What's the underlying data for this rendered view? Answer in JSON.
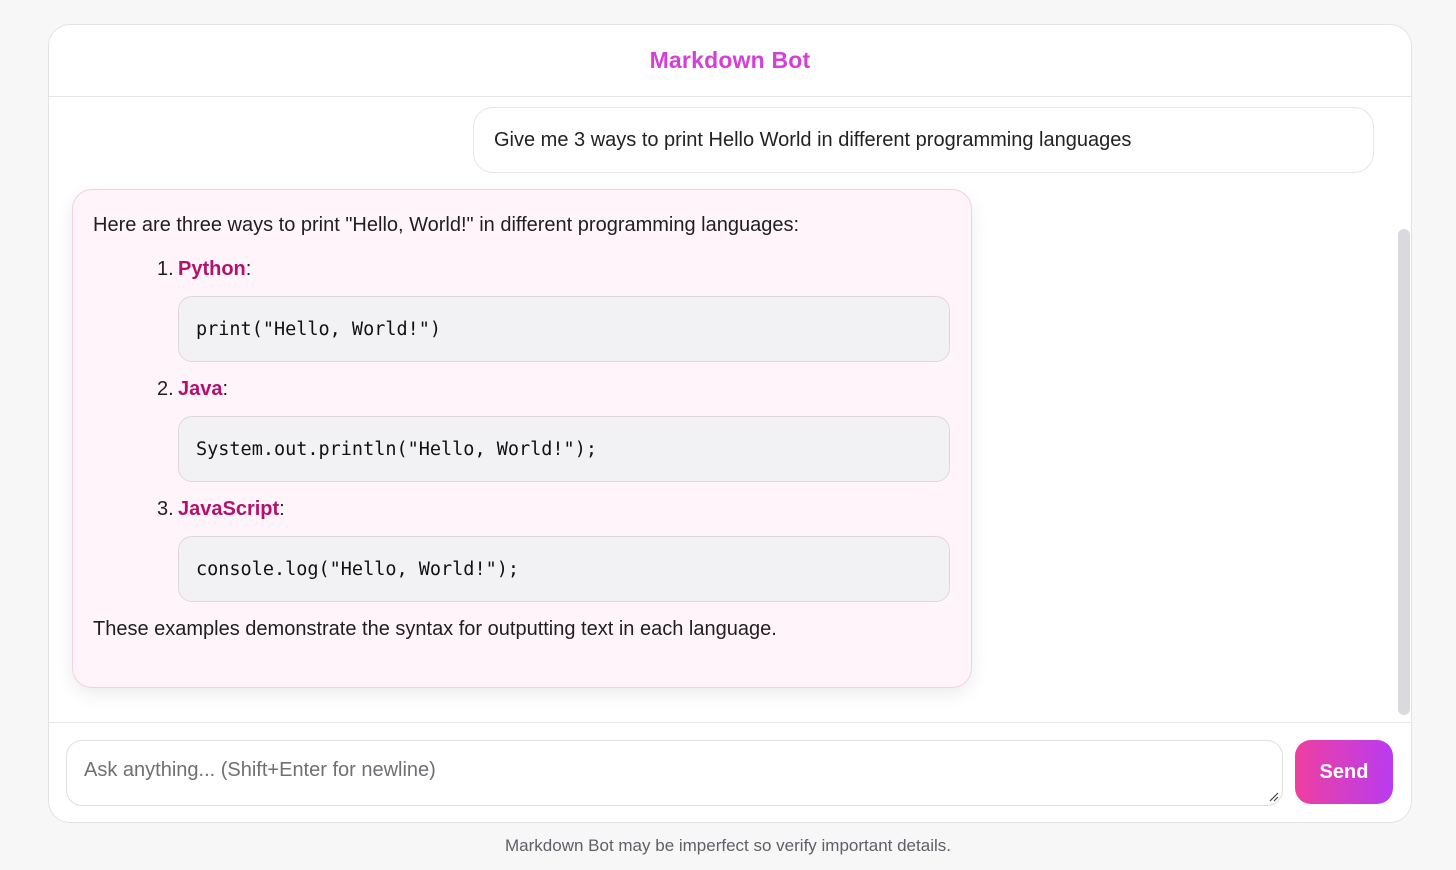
{
  "header": {
    "title": "Markdown Bot"
  },
  "conversation": {
    "user_message": "Give me 3 ways to print Hello World in different programming languages",
    "bot_message": {
      "intro": "Here are three ways to print \"Hello, World!\" in different programming languages:",
      "items": [
        {
          "number": "1.",
          "language": "Python",
          "suffix": ":",
          "code": "print(\"Hello, World!\")"
        },
        {
          "number": "2.",
          "language": "Java",
          "suffix": ":",
          "code": "System.out.println(\"Hello, World!\");"
        },
        {
          "number": "3.",
          "language": "JavaScript",
          "suffix": ":",
          "code": "console.log(\"Hello, World!\");"
        }
      ],
      "outro": "These examples demonstrate the syntax for outputting text in each language."
    }
  },
  "composer": {
    "placeholder": "Ask anything... (Shift+Enter for newline)",
    "value": "",
    "send_label": "Send"
  },
  "footer": {
    "disclaimer": "Markdown Bot may be imperfect so verify important details."
  },
  "colors": {
    "brand": "#d63fd6",
    "language_highlight": "#b0126e",
    "bot_bubble": "#fff4fa",
    "send_gradient_start": "#ef3fa0",
    "send_gradient_end": "#b93cf0"
  },
  "icons": {
    "textarea_resize": "resize-handle-icon"
  }
}
